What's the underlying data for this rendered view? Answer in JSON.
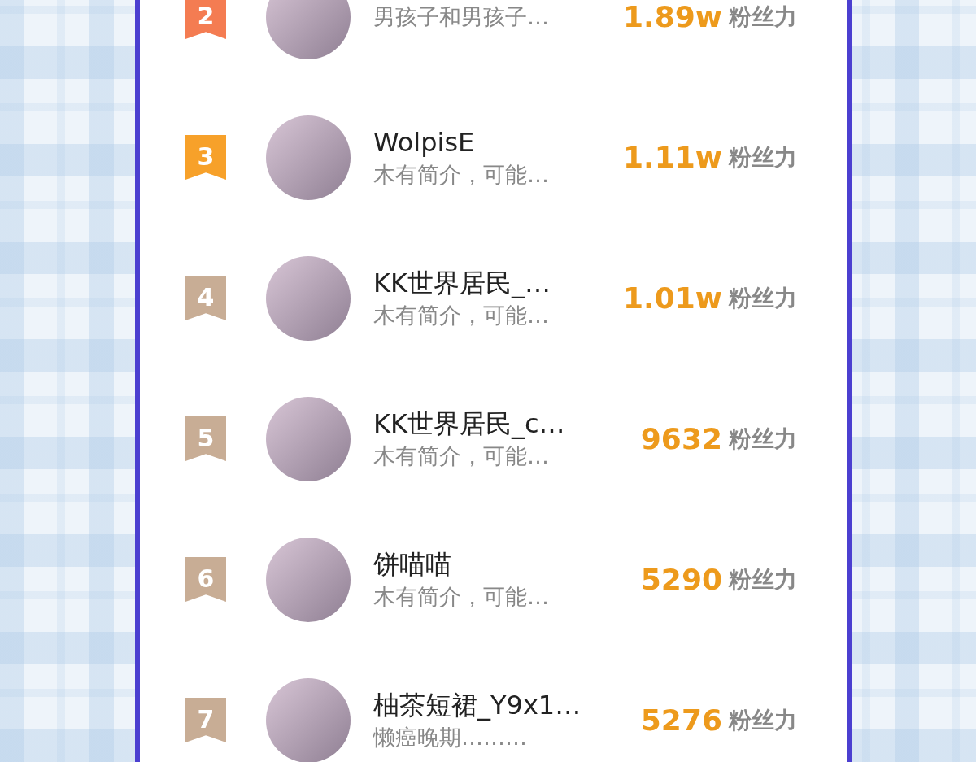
{
  "ranking": [
    {
      "rank": "2",
      "color": "#f47c52",
      "bio": "男孩子和男孩子…",
      "score": "1.89w",
      "score_unit": "粉丝力"
    },
    {
      "rank": "3",
      "color": "#f7a12a",
      "name": "WolpisE",
      "bio": "木有简介，可能…",
      "score": "1.11w",
      "score_unit": "粉丝力"
    },
    {
      "rank": "4",
      "color": "#c8ad95",
      "name": "KK世界居民_…",
      "bio": "木有简介，可能…",
      "score": "1.01w",
      "score_unit": "粉丝力"
    },
    {
      "rank": "5",
      "color": "#c8ad95",
      "name": "KK世界居民_c…",
      "bio": "木有简介，可能…",
      "score": "9632",
      "score_unit": "粉丝力"
    },
    {
      "rank": "6",
      "color": "#c8ad95",
      "name": "饼喵喵",
      "bio": "木有简介，可能…",
      "score": "5290",
      "score_unit": "粉丝力"
    },
    {
      "rank": "7",
      "color": "#c8ad95",
      "name": "柚茶短裙_Y9x1…",
      "bio": "懒癌晚期………",
      "score": "5276",
      "score_unit": "粉丝力"
    }
  ]
}
